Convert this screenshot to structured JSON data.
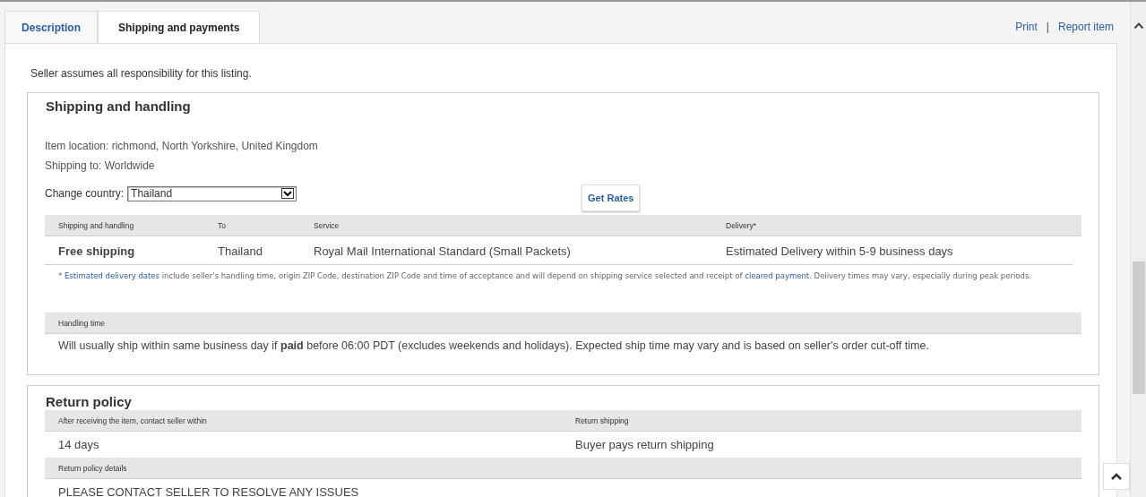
{
  "tabs": [
    {
      "label": "Description",
      "selected": false
    },
    {
      "label": "Shipping and payments",
      "selected": true
    }
  ],
  "top_links": [
    "Print",
    "|",
    "Report item"
  ],
  "seller_note": "Seller assumes all responsibility for this listing.",
  "shipping": {
    "title": "Shipping and handling",
    "location": "Item location: richmond, North Yorkshire, United Kingdom",
    "ship_to": "Shipping to: Worldwide",
    "country_label": "Change country:",
    "country_value": "Thailand",
    "button": "Get Rates",
    "columns": [
      "Shipping and handling",
      "To",
      "Service",
      "Delivery*"
    ],
    "rows": [
      [
        "Free shipping",
        "Thailand",
        "Royal Mail International Standard (Small Packets)",
        "Estimated Delivery within 5-9 business days"
      ]
    ],
    "footnote": [
      {
        "kind": "text",
        "text": "* "
      },
      {
        "kind": "link",
        "text": "Estimated delivery dates"
      },
      {
        "kind": "text",
        "text": " include seller's handling time, origin ZIP Code, destination ZIP Code and time of acceptance and will depend on shipping service selected and receipt of "
      },
      {
        "kind": "link",
        "text": "cleared payment."
      },
      {
        "kind": "text",
        "text": " Delivery times may vary, especially during peak periods."
      }
    ],
    "handling_header": "Handling time",
    "handling_text": "Will usually ship within same business day if **paid** before 06:00 PDT (excludes weekends and holidays). Expected ship time may vary and is based on seller's order cut-off time."
  },
  "returns": {
    "title": "Return policy",
    "columns": [
      "After receiving the item, contact seller within",
      "Return shipping"
    ],
    "values": [
      "14 days",
      "Buyer pays return shipping"
    ],
    "details_header": "Return policy details",
    "details": "PLEASE CONTACT SELLER TO RESOLVE ANY ISSUES"
  }
}
